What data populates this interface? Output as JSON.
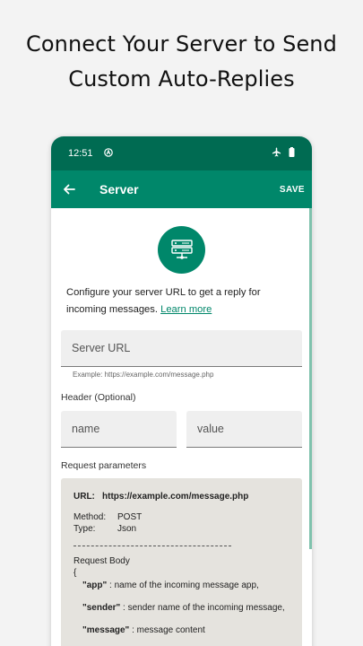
{
  "promo": {
    "line1": "Connect Your Server to Send",
    "line2": "Custom Auto-Replies"
  },
  "status_bar": {
    "time": "12:51",
    "icons": [
      "automation-icon",
      "airplane-icon",
      "battery-icon"
    ]
  },
  "app_bar": {
    "title": "Server",
    "save_label": "SAVE",
    "back_icon": "arrow-left-icon"
  },
  "intro": {
    "icon": "server-icon",
    "text": "Configure your server URL to get a reply for incoming messages.",
    "link": "Learn more"
  },
  "server_url": {
    "placeholder": "Server URL",
    "helper": "Example: https://example.com/message.php"
  },
  "header_section": {
    "label": "Header (Optional)",
    "name_placeholder": "name",
    "value_placeholder": "value"
  },
  "request_params": {
    "label": "Request parameters",
    "url_label": "URL:",
    "url_value": "https://example.com/message.php",
    "method_label": "Method:",
    "method_value": "POST",
    "type_label": "Type:",
    "type_value": "Json",
    "body_title": "Request Body",
    "open_brace": "{",
    "app_key": "\"app\"",
    "app_desc": " : name of the incoming message app,",
    "sender_key": "\"sender\"",
    "sender_desc": " : sender name of the incoming message,",
    "message_key": "\"message\"",
    "message_desc": " : message content"
  },
  "colors": {
    "status_bar": "#006b52",
    "app_bar": "#00876a",
    "accent": "#00876a",
    "field_bg": "#efefef",
    "params_bg": "#e5e3de"
  }
}
